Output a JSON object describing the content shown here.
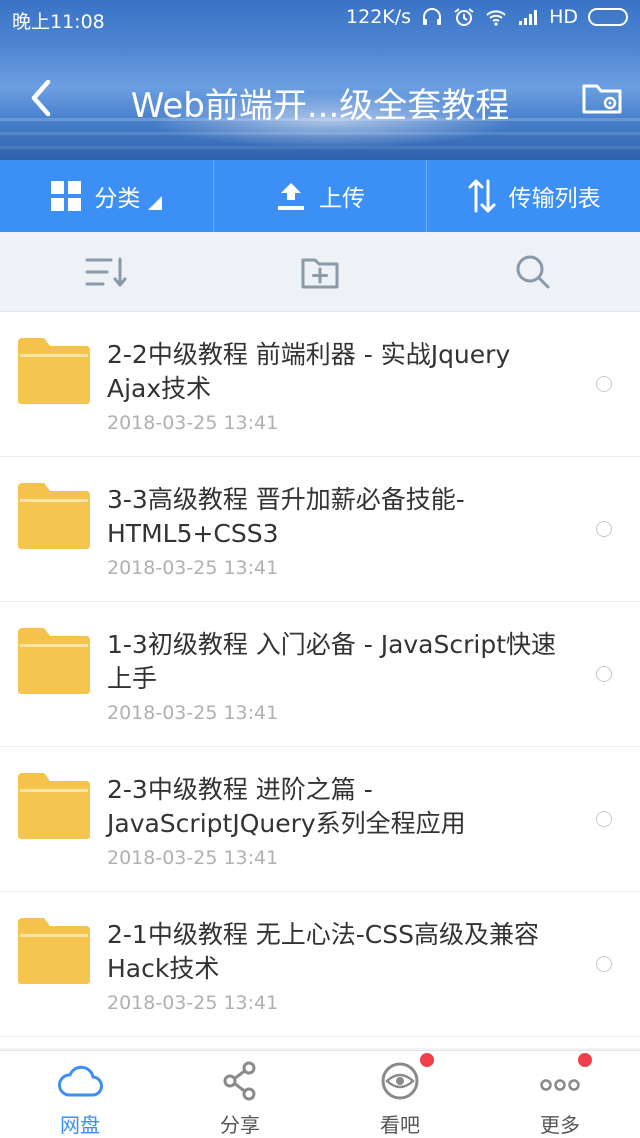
{
  "status_bar": {
    "time": "晚上11:08",
    "speed": "122K/s",
    "network": "HD"
  },
  "header": {
    "title": "Web前端开...级全套教程"
  },
  "tabs": [
    {
      "label": "分类",
      "icon": "grid-icon"
    },
    {
      "label": "上传",
      "icon": "upload-icon"
    },
    {
      "label": "传输列表",
      "icon": "transfer-icon"
    }
  ],
  "toolbar": [
    "sort-icon",
    "new-folder-icon",
    "search-icon"
  ],
  "files": [
    {
      "name": "2-2中级教程 前端利器 - 实战Jquery Ajax技术",
      "date": "2018-03-25  13:41"
    },
    {
      "name": "3-3高级教程 晋升加薪必备技能-HTML5+CSS3",
      "date": "2018-03-25  13:41"
    },
    {
      "name": "1-3初级教程 入门必备 - JavaScript快速上手",
      "date": "2018-03-25  13:41"
    },
    {
      "name": "2-3中级教程 进阶之篇 - JavaScriptJQuery系列全程应用",
      "date": "2018-03-25  13:41"
    },
    {
      "name": "2-1中级教程 无上心法-CSS高级及兼容Hack技术",
      "date": "2018-03-25  13:41"
    }
  ],
  "bottom_nav": [
    {
      "label": "网盘",
      "icon": "cloud-icon",
      "active": true,
      "badge": false
    },
    {
      "label": "分享",
      "icon": "share-icon",
      "active": false,
      "badge": false
    },
    {
      "label": "看吧",
      "icon": "eye-icon",
      "active": false,
      "badge": true
    },
    {
      "label": "更多",
      "icon": "more-icon",
      "active": false,
      "badge": true
    }
  ],
  "colors": {
    "accent": "#3b8ff5",
    "folder": "#f5c24c",
    "badge": "#f0404a"
  }
}
